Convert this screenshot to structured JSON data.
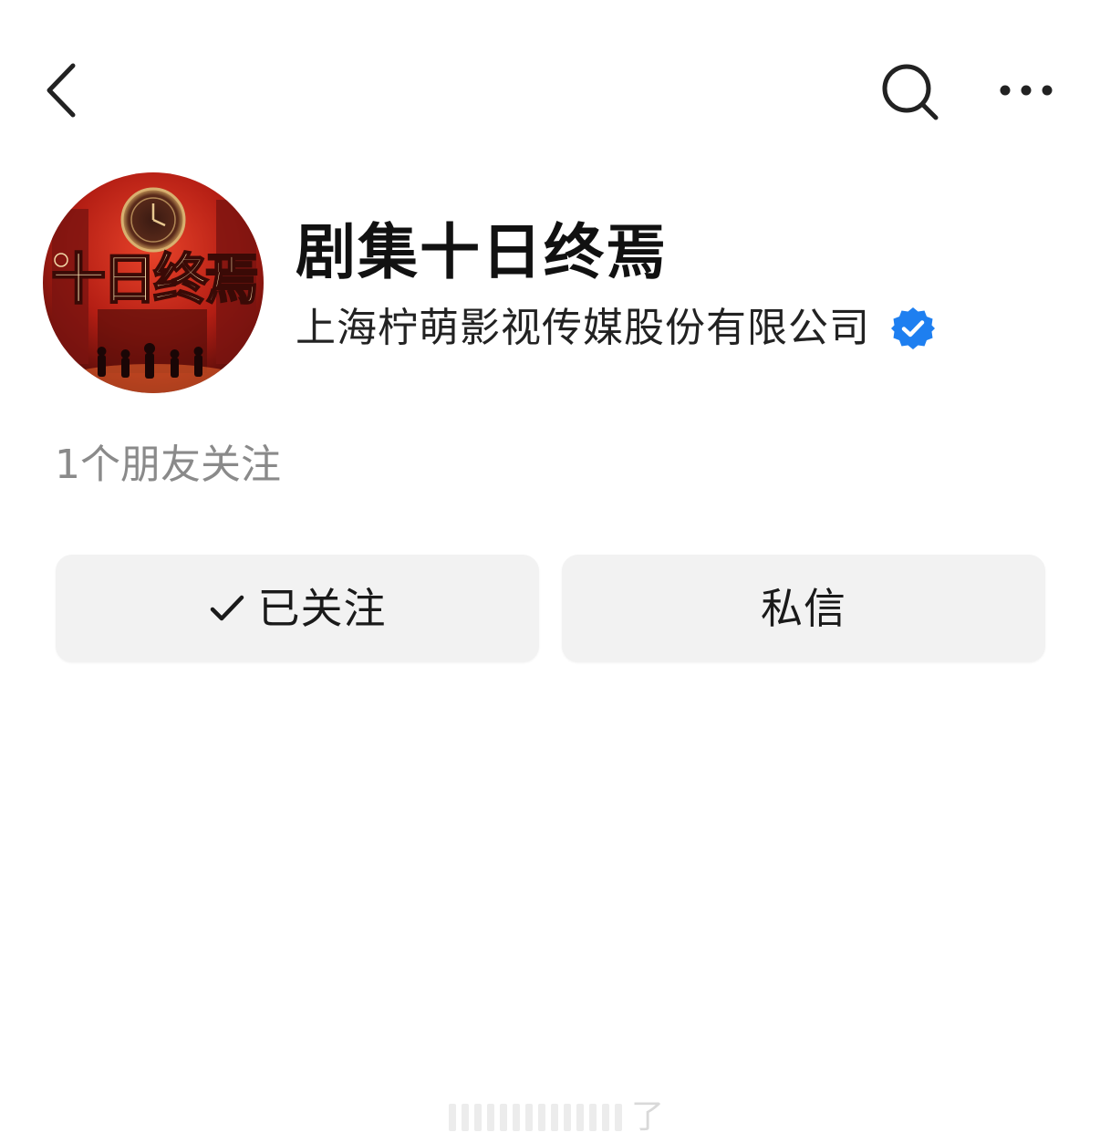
{
  "header": {
    "back_icon": "chevron-left-icon",
    "search_icon": "search-icon",
    "more_icon": "more-horizontal-icon"
  },
  "profile": {
    "name": "剧集十日终焉",
    "company": "上海柠萌影视传媒股份有限公司",
    "verified_icon": "verified-badge-icon",
    "verified_color": "#1e7ff0",
    "friends_follow": "1个朋友关注",
    "avatar_title": "十日终焉"
  },
  "actions": {
    "follow_label": "已关注",
    "follow_icon": "check-icon",
    "message_label": "私信"
  },
  "overlay": {
    "text": "了"
  }
}
